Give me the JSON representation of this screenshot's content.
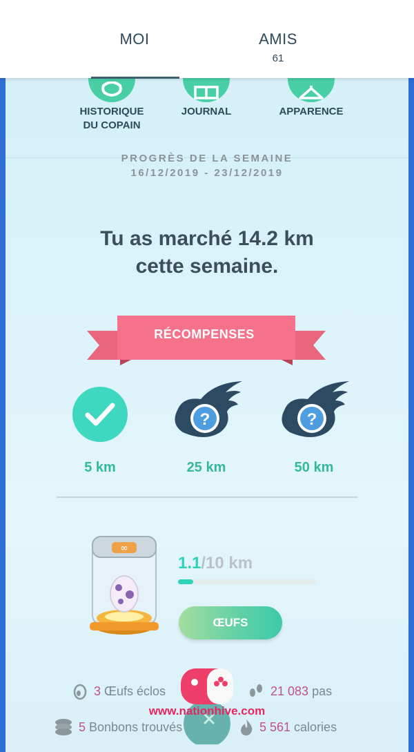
{
  "tabs": [
    {
      "label": "MOI",
      "sub": ""
    },
    {
      "label": "AMIS",
      "sub": "61"
    }
  ],
  "icons": [
    {
      "label_line1": "HISTORIQUE",
      "label_line2": "DU COPAIN",
      "icon": "buddy-history-icon"
    },
    {
      "label_line1": "JOURNAL",
      "label_line2": "",
      "icon": "journal-book-icon"
    },
    {
      "label_line1": "APPARENCE",
      "label_line2": "",
      "icon": "hanger-icon"
    }
  ],
  "week": {
    "title": "PROGRÈS DE LA SEMAINE",
    "dates": "16/12/2019 - 23/12/2019"
  },
  "summary": {
    "line1": "Tu as marché 14.2 km",
    "line2": "cette semaine."
  },
  "rewards": {
    "title": "RÉCOMPENSES",
    "items": [
      {
        "label": "5 km",
        "state": "completed",
        "icon": "check-icon"
      },
      {
        "label": "25 km",
        "state": "locked",
        "icon": "question-icon"
      },
      {
        "label": "50 km",
        "state": "locked",
        "icon": "question-icon"
      }
    ]
  },
  "incubator": {
    "current": "1.1",
    "total": "/10 km",
    "progress_fraction": 0.11,
    "button": "ŒUFS"
  },
  "stats": [
    {
      "num": "3",
      "text": "Œufs éclos",
      "icon": "egg-icon"
    },
    {
      "num": "21 083",
      "text": "pas",
      "icon": "footprints-icon"
    },
    {
      "num": "5",
      "text": "Bonbons trouvés",
      "icon": "candy-icon"
    },
    {
      "num": "5 561",
      "text": "calories",
      "icon": "flame-icon"
    }
  ],
  "watermark": {
    "text": "www.nationhive.com"
  },
  "colors": {
    "accent": "#48cfa6",
    "ribbon": "#f0627e",
    "stat_number": "#c2508f"
  }
}
